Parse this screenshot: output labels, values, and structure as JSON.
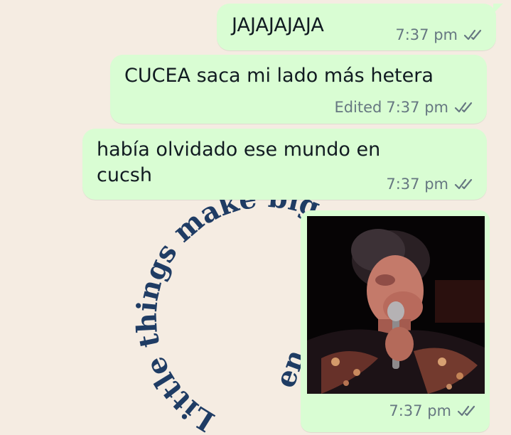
{
  "wallpaper": {
    "curved_text_top": "Little things make big",
    "curved_text_end": "en"
  },
  "messages": [
    {
      "text_lines": [
        "JAJAJAJAJA"
      ],
      "edited_label": "",
      "time": "7:37 pm",
      "status_icon": "double-check-read-icon"
    },
    {
      "text_lines": [
        "CUCEA saca mi lado más hetera"
      ],
      "edited_label": "Edited",
      "time": "7:37 pm",
      "status_icon": "double-check-read-icon"
    },
    {
      "text_lines": [
        "había olvidado ese mundo en",
        "cucsh"
      ],
      "edited_label": "",
      "time": "7:37 pm",
      "status_icon": "double-check-read-icon"
    },
    {
      "type": "gif",
      "time": "7:37 pm",
      "status_icon": "double-check-read-icon"
    }
  ],
  "colors": {
    "chat_background": "#f5ece2",
    "outgoing_bubble": "#d9fdd3",
    "wallpaper_text": "#1f3c64",
    "meta_text": "#667781"
  }
}
